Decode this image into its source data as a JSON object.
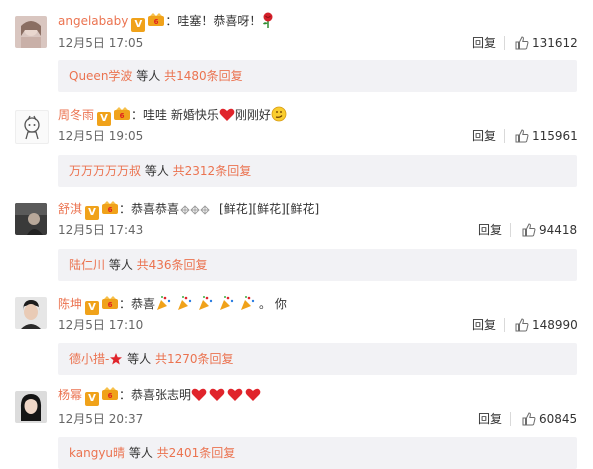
{
  "comments": [
    {
      "username": "angelababy",
      "content": "：哇塞！恭喜呀！",
      "time": "12月5日 17:05",
      "reply_label": "回复",
      "likes": "131612",
      "sub_user": "Queen学波",
      "sub_mid": " 等人 ",
      "sub_count": "共1480条回复",
      "emoji": [
        "rose-icon"
      ]
    },
    {
      "username": "周冬雨",
      "content": "：哇哇 新婚快乐",
      "content_after": "刚刚好",
      "time": "12月5日 19:05",
      "reply_label": "回复",
      "likes": "115961",
      "sub_user": "万万万万万叔",
      "sub_mid": " 等人 ",
      "sub_count": "共2312条回复",
      "emoji": [
        "heart-icon",
        "smirk-icon"
      ]
    },
    {
      "username": "舒淇",
      "content": "：恭喜恭喜",
      "content_after": "[鲜花][鲜花][鲜花]",
      "time": "12月5日 17:43",
      "reply_label": "回复",
      "likes": "94418",
      "sub_user": "陆仁川",
      "sub_mid": " 等人 ",
      "sub_count": "共436条回复",
      "emoji": [
        "sparkle-icon"
      ]
    },
    {
      "username": "陈坤",
      "content": "：恭喜",
      "content_after": "。 你",
      "time": "12月5日 17:10",
      "reply_label": "回复",
      "likes": "148990",
      "sub_user": "德小措-",
      "sub_mid": " 等人 ",
      "sub_count": "共1270条回复",
      "emoji": [
        "party-popper-icon"
      ]
    },
    {
      "username": "杨幂",
      "content": "：恭喜张志明",
      "time": "12月5日 20:37",
      "reply_label": "回复",
      "likes": "60845",
      "sub_user": "kangyu晴",
      "sub_mid": " 等人 ",
      "sub_count": "共2401条回复",
      "emoji": [
        "heart-icon"
      ]
    }
  ],
  "colors": {
    "username": "#eb7350",
    "badge_v": "#f0a21a",
    "sub_background": "#f2f2f5",
    "heart": "#e0242b"
  }
}
